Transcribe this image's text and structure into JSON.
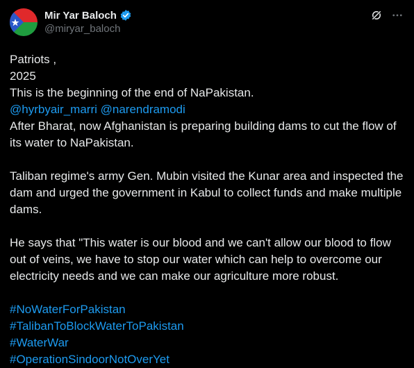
{
  "author": {
    "display_name": "Mir Yar Baloch",
    "handle": "@miryar_baloch",
    "verified_color": "#1d9bf0"
  },
  "icons": {
    "grok": "grok-icon",
    "more": "more-icon",
    "verified": "verified-badge-icon"
  },
  "colors": {
    "background": "#000000",
    "text": "#e7e9ea",
    "muted": "#71767b",
    "link": "#1d9bf0"
  },
  "post": {
    "line1": "Patriots ,",
    "line2": "2025",
    "line3": "This is the beginning of the end of NaPakistan.",
    "mention1": "@hyrbyair_marri",
    "mention2": "@narendramodi",
    "line5": "After Bharat, now Afghanistan is preparing building dams to cut the flow of its water to NaPakistan.",
    "para2": "Taliban regime's army Gen. Mubin visited the Kunar area and inspected the dam and urged the government in Kabul to collect funds and make multiple dams.",
    "para3": "He says that \"This water is our blood and we can't allow our blood to flow out of veins, we have to stop our water which can help to overcome our electricity needs and we can make our agriculture more robust.",
    "hashtags": [
      "#NoWaterForPakistan",
      "#TalibanToBlockWaterToPakistan",
      "#WaterWar",
      "#OperationSindoorNotOverYet"
    ]
  }
}
